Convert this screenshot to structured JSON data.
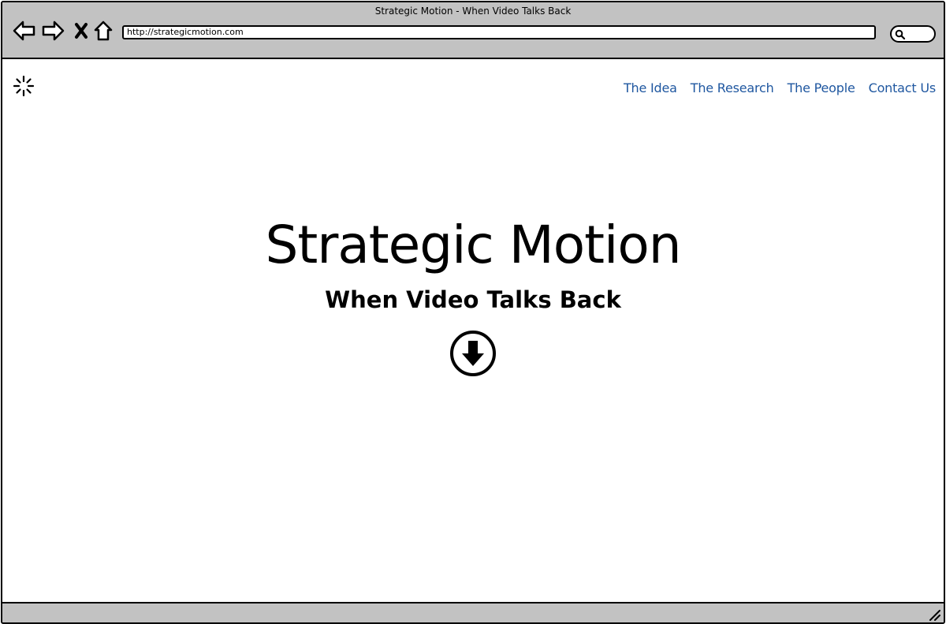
{
  "window": {
    "title": "Strategic Motion - When Video Talks Back"
  },
  "toolbar": {
    "back_icon": "back-arrow-icon",
    "forward_icon": "forward-arrow-icon",
    "stop_icon": "close-icon",
    "home_icon": "home-icon",
    "url": "http://strategicmotion.com",
    "search_icon": "search-icon"
  },
  "header": {
    "logo_icon": "loading-spinner-icon",
    "nav": [
      {
        "label": "The Idea"
      },
      {
        "label": "The Research"
      },
      {
        "label": "The People"
      },
      {
        "label": "Contact Us"
      }
    ]
  },
  "hero": {
    "title": "Strategic Motion",
    "subtitle": "When Video Talks Back",
    "scroll_icon": "arrow-down-circle-icon"
  },
  "colors": {
    "chrome": "#c2c2c2",
    "link": "#1f57a0",
    "text": "#000000",
    "background": "#ffffff"
  }
}
